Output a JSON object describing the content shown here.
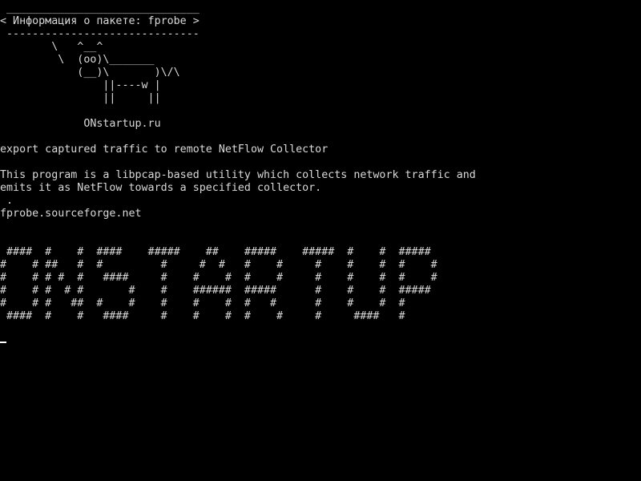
{
  "terminal": {
    "cowsay": {
      "top_border": " ______________________________",
      "title": "< Информация о пакете: fprobe >",
      "bottom_border": " ------------------------------",
      "cow": [
        "        \\   ^__^",
        "         \\  (oo)\\_______",
        "            (__)\\       )\\/\\",
        "                ||----w |",
        "                ||     ||"
      ],
      "blank": "",
      "site": "             ONstartup.ru"
    },
    "summary": "export captured traffic to remote NetFlow Collector",
    "description": [
      "This program is a libpcap-based utility which collects network traffic and",
      "emits it as NetFlow towards a specified collector.",
      " .",
      "fprobe.sourceforge.net"
    ],
    "banner": [
      " ####  #    #  ####    #####    ##    #####    #####  #    #  #####",
      "#    # ##   #  #         #     #  #   #    #     #    #    #  #    #",
      "#    # # #  #   ####     #    #    #  #    #     #    #    #  #    #",
      "#    # #  # #       #    #    ######  #####      #    #    #  #####",
      "#    # #   ##  #    #    #    #    #  #   #      #    #    #  #",
      " ####  #    #   ####     #    #    #  #    #     #     ####   #"
    ],
    "colors": {
      "background": "#000000",
      "foreground": "#d9d9d9",
      "cursor": "#ffffff"
    }
  }
}
